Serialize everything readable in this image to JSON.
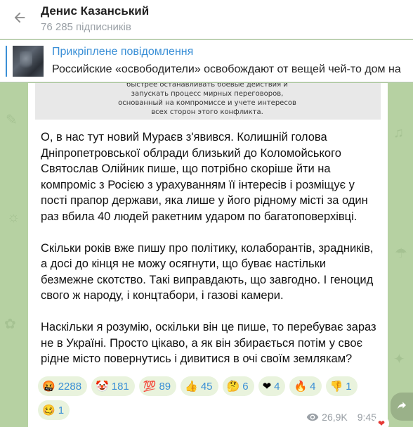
{
  "header": {
    "channel_name": "Денис Казанський",
    "subscribers": "76 285 підписників"
  },
  "pinned": {
    "title": "Прикріплене повідомлення",
    "message": "Российские «освободители» освобождают от вещей чей-то дом на"
  },
  "post_image_text": [
    "быстрее останавливать боевые действия и",
    "запускать процесс мирных переговоров,",
    "основанный на компромиссе и учете интересов",
    "всех сторон этого конфликта."
  ],
  "post": {
    "paragraphs": [
      "О, в нас тут новий Мураєв з'явився. Колишній голова Дніпропетровської облради близький до Коломойського Святослав Олійник пише, що потрібно скоріше йти на компроміс з Росією з урахуванням її інтересів і розміщує у пості прапор держави, яка лише у його рідному місті за один раз вбила 40 людей ракетним ударом по багатоповерхівці.",
      "Скільки років вже пишу про політику, колаборантів, зрадників, а досі до кінця не можу осягнути, що буває настільки безмежне скотство. Такі виправдають, що завгодно. І геноцид свого ж народу, і концтабори, і газові камери.",
      "Наскільки я розумію, оскільки він це пише, то перебуває зараз не в Україні. Просто цікаво, а як він збирається потім у своє рідне місто повернутись і дивитися в очі своїм землякам?"
    ],
    "reactions": [
      {
        "emoji": "🤬",
        "count": "2288",
        "name": "reaction-angry"
      },
      {
        "emoji": "🤡",
        "count": "181",
        "name": "reaction-clown"
      },
      {
        "emoji": "💯",
        "count": "89",
        "name": "reaction-hundred"
      },
      {
        "emoji": "👍",
        "count": "45",
        "name": "reaction-thumbs-up"
      },
      {
        "emoji": "🤔",
        "count": "6",
        "name": "reaction-thinking"
      },
      {
        "emoji": "❤",
        "count": "4",
        "name": "reaction-heart"
      },
      {
        "emoji": "🔥",
        "count": "4",
        "name": "reaction-fire"
      },
      {
        "emoji": "👎",
        "count": "1",
        "name": "reaction-thumbs-down"
      },
      {
        "emoji": "🥴",
        "count": "1",
        "name": "reaction-woozy"
      }
    ],
    "views": "26,9K",
    "time": "9:45"
  },
  "colors": {
    "accent": "#3a8fd6",
    "reaction_bg": "#e9f3dd",
    "chat_bg": "#b6d1a2"
  },
  "icons": {
    "back": "arrow-left-icon",
    "views": "eye-icon",
    "share": "share-arrow-icon",
    "heart": "heart-icon"
  }
}
